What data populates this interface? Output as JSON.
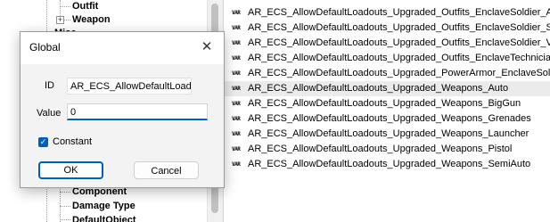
{
  "tree": {
    "items": [
      {
        "label": "Outfit"
      },
      {
        "label": "Weapon",
        "expander": "+"
      },
      {
        "label": "Misc"
      },
      {
        "label": "Component"
      },
      {
        "label": "Damage Type"
      },
      {
        "label": "DefaultObject"
      }
    ]
  },
  "list": {
    "icon_text": "VAR",
    "items": [
      "AR_ECS_AllowDefaultLoadouts_Upgraded_Outfits_EnclaveSoldier_AtE",
      "AR_ECS_AllowDefaultLoadouts_Upgraded_Outfits_EnclaveSoldier_Sta",
      "AR_ECS_AllowDefaultLoadouts_Upgraded_Outfits_EnclaveSoldier_Va",
      "AR_ECS_AllowDefaultLoadouts_Upgraded_Outfits_EnclaveTechnician",
      "AR_ECS_AllowDefaultLoadouts_Upgraded_PowerArmor_EnclaveSoldie",
      "AR_ECS_AllowDefaultLoadouts_Upgraded_Weapons_Auto",
      "AR_ECS_AllowDefaultLoadouts_Upgraded_Weapons_BigGun",
      "AR_ECS_AllowDefaultLoadouts_Upgraded_Weapons_Grenades",
      "AR_ECS_AllowDefaultLoadouts_Upgraded_Weapons_Launcher",
      "AR_ECS_AllowDefaultLoadouts_Upgraded_Weapons_Pistol",
      "AR_ECS_AllowDefaultLoadouts_Upgraded_Weapons_SemiAuto"
    ]
  },
  "dialog": {
    "title": "Global",
    "close_glyph": "✕",
    "id_label": "ID",
    "id_value": "AR_ECS_AllowDefaultLoado",
    "value_label": "Value",
    "value_value": "0",
    "constant_label": "Constant",
    "constant_checked": "✓",
    "ok_label": "OK",
    "cancel_label": "Cancel"
  }
}
